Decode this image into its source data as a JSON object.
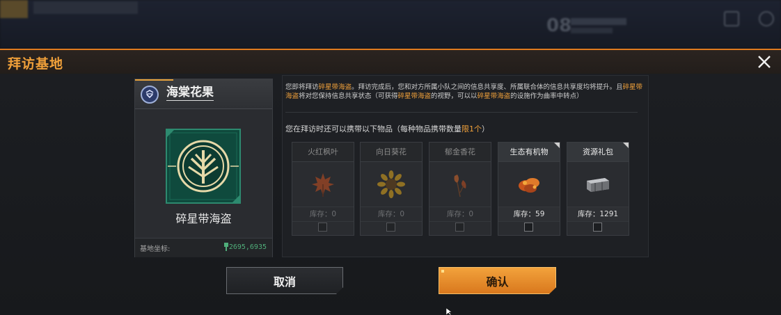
{
  "window": {
    "title": "拜访基地",
    "close_icon": "close-icon"
  },
  "base": {
    "name": "海棠花果",
    "label": "碎星带海盗",
    "coord_label": "基地坐标:",
    "coord_value": "2695,6935"
  },
  "info": {
    "desc_1": "您即将拜访",
    "desc_hl_1": "碎星带海盗",
    "desc_2": "。拜访完成后，您和对方所属小队之间的信息共享度、所属联合体的信息共享度均将提升。且",
    "desc_hl_2": "碎星带海盗",
    "desc_3": "将对您保持信息共享状态（可获得",
    "desc_hl_3": "碎星带海盗",
    "desc_4": "的视野，可以以",
    "desc_hl_4": "碎星带海盗",
    "desc_5": "的设施作为曲率中转点）",
    "subtitle_1": "您在拜访时还可以携带以下物品（每种物品携带数量",
    "subtitle_hl": "限1个",
    "subtitle_2": "）"
  },
  "items": [
    {
      "name": "火红枫叶",
      "stock": "库存：0",
      "active": false,
      "icon": "maple-leaf-icon"
    },
    {
      "name": "向日葵花",
      "stock": "库存：0",
      "active": false,
      "icon": "sunflower-icon"
    },
    {
      "name": "郁金香花",
      "stock": "库存：0",
      "active": false,
      "icon": "tulip-icon"
    },
    {
      "name": "生态有机物",
      "stock": "库存：59",
      "active": true,
      "icon": "organic-matter-icon"
    },
    {
      "name": "资源礼包",
      "stock": "库存：1291",
      "active": true,
      "icon": "resource-pack-icon"
    }
  ],
  "buttons": {
    "cancel": "取消",
    "confirm": "确认"
  },
  "colors": {
    "accent": "#f0a03a",
    "coord": "#4fae7a",
    "logo": "#1f6e5a"
  }
}
